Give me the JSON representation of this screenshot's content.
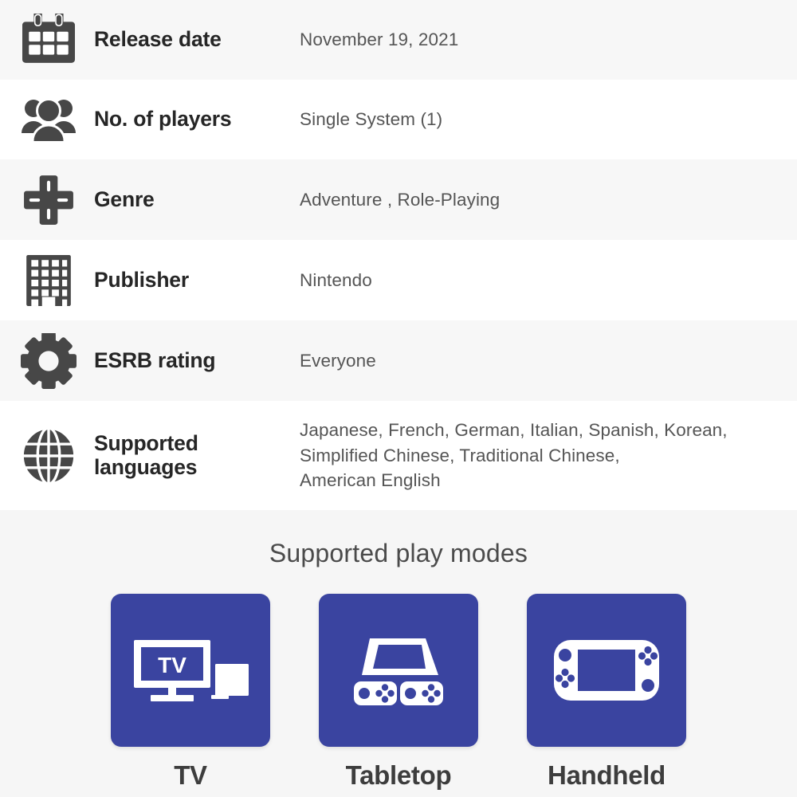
{
  "specs": {
    "rows": [
      {
        "icon": "calendar-icon",
        "label": "Release date",
        "value": "November 19, 2021"
      },
      {
        "icon": "players-group-icon",
        "label": "No. of players",
        "value": "Single System (1)"
      },
      {
        "icon": "dpad-icon",
        "label": "Genre",
        "value": "Adventure , Role-Playing"
      },
      {
        "icon": "building-icon",
        "label": "Publisher",
        "value": "Nintendo"
      },
      {
        "icon": "gear-icon",
        "label": "ESRB rating",
        "value": "Everyone"
      },
      {
        "icon": "globe-icon",
        "label_line1": "Supported",
        "label_line2": "languages",
        "value_line1": "Japanese, French, German, Italian, Spanish, Korean,",
        "value_line2": "Simplified Chinese, Traditional Chinese,",
        "value_line3": "American English"
      }
    ]
  },
  "play_modes": {
    "title": "Supported play modes",
    "card_color": "#3a44a0",
    "items": [
      {
        "icon": "tv-dock-icon",
        "label": "TV",
        "screen_text": "TV"
      },
      {
        "icon": "tabletop-console-icon",
        "label": "Tabletop"
      },
      {
        "icon": "handheld-console-icon",
        "label": "Handheld"
      }
    ]
  },
  "colors": {
    "row_alt_background": "#f7f7f7",
    "row_background": "#ffffff",
    "section_background": "#f6f6f6",
    "icon_gray": "#474747",
    "label_text": "#262626",
    "value_text": "#555555"
  }
}
